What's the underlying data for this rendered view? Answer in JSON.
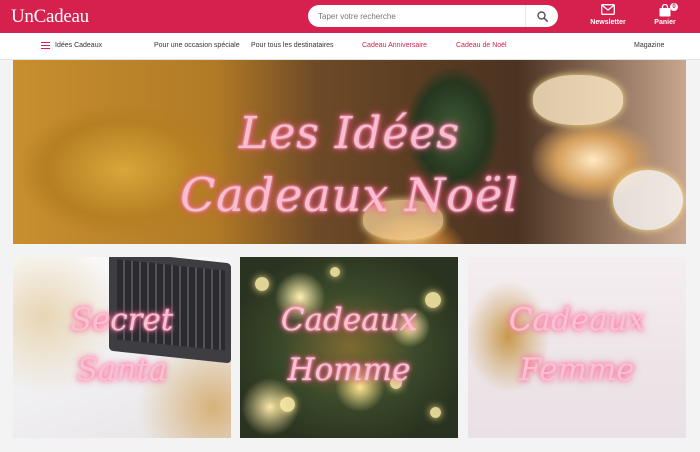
{
  "header": {
    "logo": "UnCadeau",
    "search_placeholder": "Taper votre recherche",
    "newsletter_label": "Newsletter",
    "cart_label": "Panier",
    "cart_count": "0"
  },
  "nav": {
    "menu_label": "Idées Cadeaux",
    "items": [
      {
        "label": "Pour une occasion spéciale"
      },
      {
        "label": "Pour tous les destinataires"
      },
      {
        "label": "Cadeau Anniversaire"
      },
      {
        "label": "Cadeau de Noël"
      },
      {
        "label": "Magazine"
      }
    ]
  },
  "hero": {
    "line1": "Les Idées",
    "line2": "Cadeaux Noël"
  },
  "cards": [
    {
      "line1": "Secret",
      "line2": "Santa"
    },
    {
      "line1": "Cadeaux",
      "line2": "Homme"
    },
    {
      "line1": "Cadeaux",
      "line2": "Femme"
    }
  ],
  "colors": {
    "brand": "#d6204e",
    "neon_text": "#f6bfd0"
  }
}
